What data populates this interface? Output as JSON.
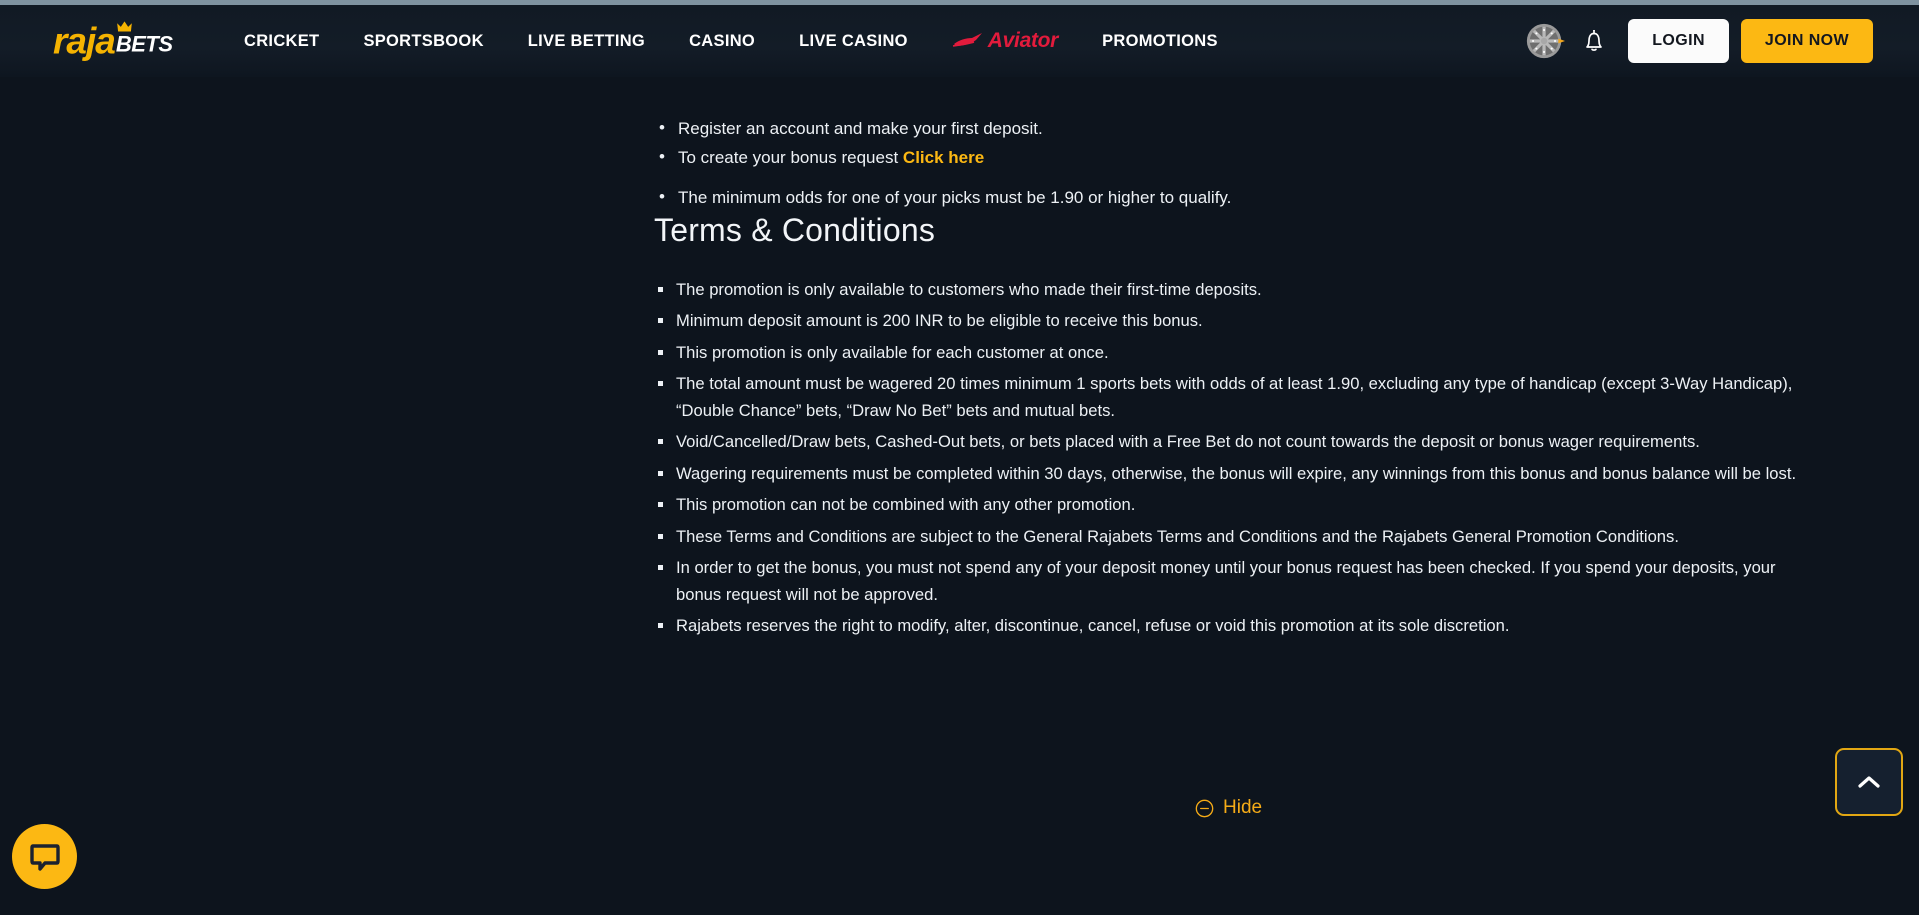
{
  "brand": {
    "logo_primary": "raja",
    "logo_secondary": "BETS",
    "accent_color": "#fcb813",
    "aviator_color": "#e21b3c",
    "background_color": "#0d141d",
    "header_color": "#131c27"
  },
  "header": {
    "nav": [
      {
        "label": "CRICKET",
        "name": "nav-cricket"
      },
      {
        "label": "SPORTSBOOK",
        "name": "nav-sportsbook"
      },
      {
        "label": "LIVE BETTING",
        "name": "nav-live-betting"
      },
      {
        "label": "CASINO",
        "name": "nav-casino"
      },
      {
        "label": "LIVE CASINO",
        "name": "nav-live-casino"
      }
    ],
    "aviator_label": "Aviator",
    "promotions_label": "PROMOTIONS",
    "wheel_icon": "fortune-wheel-icon",
    "bell_icon": "notification-bell-icon",
    "login_label": "LOGIN",
    "join_label": "JOIN NOW"
  },
  "intro": {
    "items": [
      {
        "text": "Register an account and make your first deposit."
      },
      {
        "text": "To create your bonus request ",
        "link": "Click here"
      },
      {
        "text": "The minimum odds for one of your picks must be 1.90 or higher to qualify."
      }
    ]
  },
  "terms": {
    "title": "Terms & Conditions",
    "items": [
      "The promotion is only available to customers who made their first-time deposits.",
      "Minimum deposit amount is 200 INR to be eligible to receive this bonus.",
      "This promotion is only available for each customer at once.",
      "The total amount must be wagered 20 times minimum 1 sports bets with odds of at least 1.90, excluding any type of handicap (except 3-Way Handicap), “Double Chance” bets, “Draw No Bet” bets and mutual bets.",
      "Void/Cancelled/Draw bets, Cashed-Out bets, or bets placed with a Free Bet do not count towards the deposit or bonus wager requirements.",
      "Wagering requirements must be completed within 30 days, otherwise, the bonus will expire, any winnings from this bonus and bonus balance will be lost.",
      "This promotion can not be combined with any other promotion.",
      "These Terms and Conditions are subject to the General Rajabets Terms and Conditions and the Rajabets General Promotion Conditions.",
      "In order to get the bonus, you must not spend any of your deposit money until your bonus request has been checked. If you spend your deposits, your bonus request will not be approved.",
      "Rajabets reserves the right to modify, alter, discontinue, cancel, refuse or void this promotion at its sole discretion."
    ]
  },
  "footer_controls": {
    "hide_label": "Hide",
    "hide_icon": "minus-circle-icon",
    "scroll_top_icon": "chevron-up-icon",
    "chat_icon": "chat-bubble-icon"
  }
}
